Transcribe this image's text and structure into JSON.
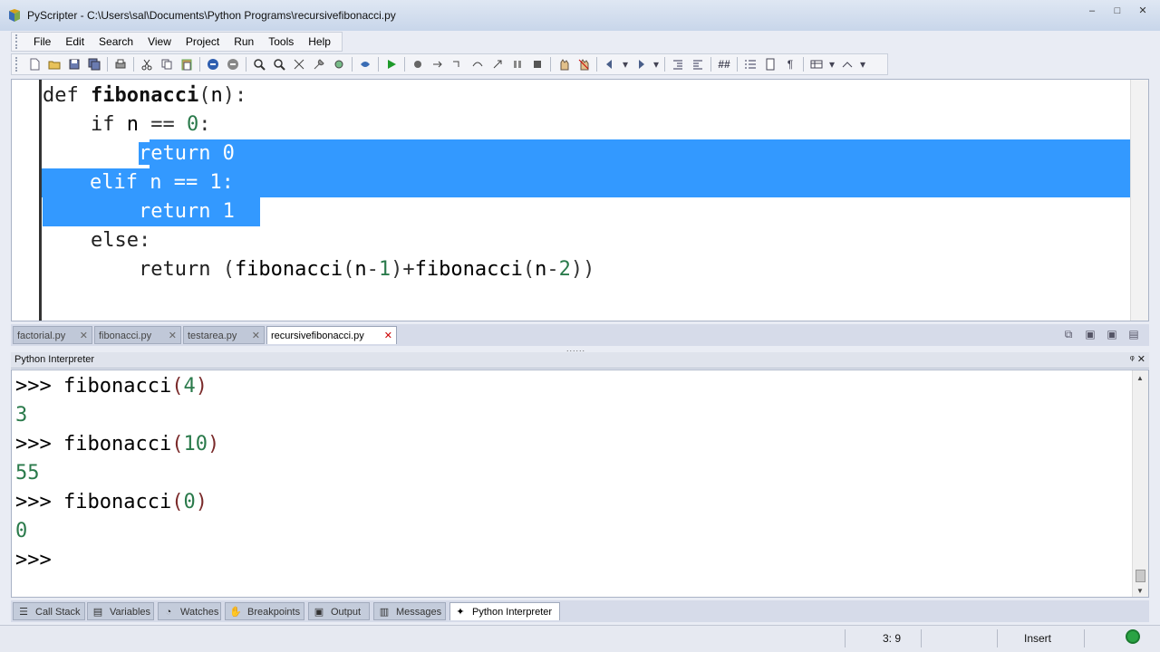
{
  "window": {
    "title": "PyScripter - C:\\Users\\sal\\Documents\\Python Programs\\recursivefibonacci.py",
    "controls": [
      "–",
      "□",
      "✕"
    ]
  },
  "menu": {
    "items": [
      "File",
      "Edit",
      "Search",
      "View",
      "Project",
      "Run",
      "Tools",
      "Help"
    ]
  },
  "editor": {
    "lines": [
      {
        "indent": "",
        "parts": [
          {
            "t": "def ",
            "c": "kw"
          },
          {
            "t": "fibonacci",
            "c": "fn"
          },
          {
            "t": "(",
            "c": "op"
          },
          {
            "t": "n",
            "c": ""
          },
          {
            "t": "):",
            "c": "op"
          }
        ]
      },
      {
        "indent": "    ",
        "parts": [
          {
            "t": "if ",
            "c": "kw"
          },
          {
            "t": "n ",
            "c": ""
          },
          {
            "t": "== ",
            "c": "op"
          },
          {
            "t": "0",
            "c": "num"
          },
          {
            "t": ":",
            "c": "op"
          }
        ]
      },
      {
        "indent": "        ",
        "parts": [
          {
            "t": "return 0",
            "c": "sel"
          }
        ]
      },
      {
        "indent": "    ",
        "parts": [
          {
            "t": "elif n == 1:",
            "c": "sel"
          }
        ]
      },
      {
        "indent": "        ",
        "parts": [
          {
            "t": "return 1",
            "c": "sel"
          }
        ]
      },
      {
        "indent": "    ",
        "parts": [
          {
            "t": "else",
            "c": "kw"
          },
          {
            "t": ":",
            "c": "op"
          }
        ]
      },
      {
        "indent": "        ",
        "parts": [
          {
            "t": "return ",
            "c": "kw"
          },
          {
            "t": "(",
            "c": "op"
          },
          {
            "t": "fibonacci",
            "c": ""
          },
          {
            "t": "(",
            "c": "op"
          },
          {
            "t": "n",
            "c": ""
          },
          {
            "t": "-",
            "c": "op"
          },
          {
            "t": "1",
            "c": "num"
          },
          {
            "t": ")+",
            "c": "op"
          },
          {
            "t": "fibonacci",
            "c": ""
          },
          {
            "t": "(",
            "c": "op"
          },
          {
            "t": "n",
            "c": ""
          },
          {
            "t": "-",
            "c": "op"
          },
          {
            "t": "2",
            "c": "num"
          },
          {
            "t": "))",
            "c": "op"
          }
        ]
      }
    ]
  },
  "file_tabs": [
    {
      "label": "factorial.py",
      "active": false
    },
    {
      "label": "fibonacci.py",
      "active": false
    },
    {
      "label": "testarea.py",
      "active": false
    },
    {
      "label": "recursivefibonacci.py",
      "active": true
    }
  ],
  "interpreter": {
    "title": "Python Interpreter",
    "header_buttons": "ᵠ ✕",
    "lines": [
      {
        "prompt": ">>> ",
        "code": "fibonacci",
        "arg": "4"
      },
      {
        "output": "3"
      },
      {
        "prompt": ">>> ",
        "code": "fibonacci",
        "arg": "10"
      },
      {
        "output": "55"
      },
      {
        "prompt": ">>> ",
        "code": "fibonacci",
        "arg": "0"
      },
      {
        "output": "0"
      },
      {
        "prompt": ">>> ",
        "code": "",
        "arg": null
      }
    ]
  },
  "bottom_tabs": [
    {
      "label": "Call Stack",
      "icon": "callstack-icon",
      "glyph": "☰",
      "active": false
    },
    {
      "label": "Variables",
      "icon": "variables-icon",
      "glyph": "▤",
      "active": false
    },
    {
      "label": "Watches",
      "icon": "watches-icon",
      "glyph": "◔",
      "active": false
    },
    {
      "label": "Breakpoints",
      "icon": "breakpoints-icon",
      "glyph": "✋",
      "active": false
    },
    {
      "label": "Output",
      "icon": "output-icon",
      "glyph": "▣",
      "active": false
    },
    {
      "label": "Messages",
      "icon": "messages-icon",
      "glyph": "▥",
      "active": false
    },
    {
      "label": "Python Interpreter",
      "icon": "python-icon",
      "glyph": "✦",
      "active": true
    }
  ],
  "status": {
    "position": "3: 9",
    "mode": "Insert"
  },
  "colors": {
    "selection": "#3399ff",
    "number": "#2a7a4b",
    "status_ok": "#2aa344"
  }
}
